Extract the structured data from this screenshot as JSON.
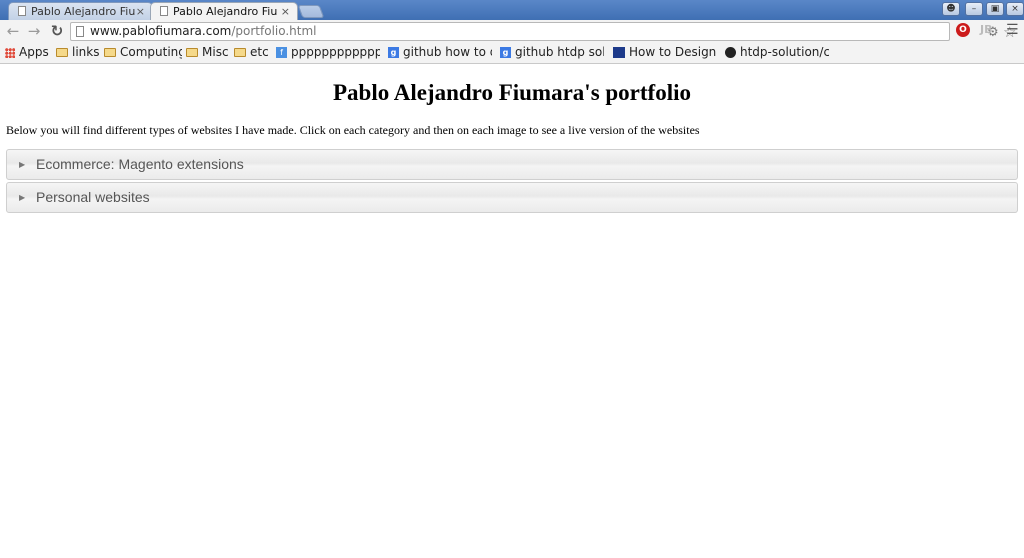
{
  "browser": {
    "tabs": [
      {
        "title": "Pablo Alejandro Fiur",
        "close": "×"
      },
      {
        "title": "Pablo Alejandro Fiur",
        "close": "×"
      }
    ],
    "url_host": "www.pablofiumara.com",
    "url_path": "/portfolio.html",
    "bookmarks": [
      {
        "label": "Apps",
        "icon": "apps-grid-icon"
      },
      {
        "label": "links",
        "icon": "folder-icon"
      },
      {
        "label": "Computing",
        "icon": "folder-icon"
      },
      {
        "label": "Misc",
        "icon": "folder-icon"
      },
      {
        "label": "etc",
        "icon": "folder-icon"
      },
      {
        "label": "ppppppppppppp",
        "icon": "bookmark-icon"
      },
      {
        "label": "github how to de",
        "icon": "google-icon"
      },
      {
        "label": "github htdp solu",
        "icon": "google-icon"
      },
      {
        "label": "How to Design Pr",
        "icon": "htdp-icon"
      },
      {
        "label": "htdp-solution/ch",
        "icon": "github-icon"
      }
    ]
  },
  "page": {
    "title": "Pablo Alejandro Fiumara's portfolio",
    "intro": "Below you will find different types of websites I have made. Click on each category and then on each image to see a live version of the websites",
    "categories": [
      {
        "label": "Ecommerce: Magento extensions",
        "expanded": false
      },
      {
        "label": "Personal websites",
        "expanded": false
      }
    ]
  }
}
